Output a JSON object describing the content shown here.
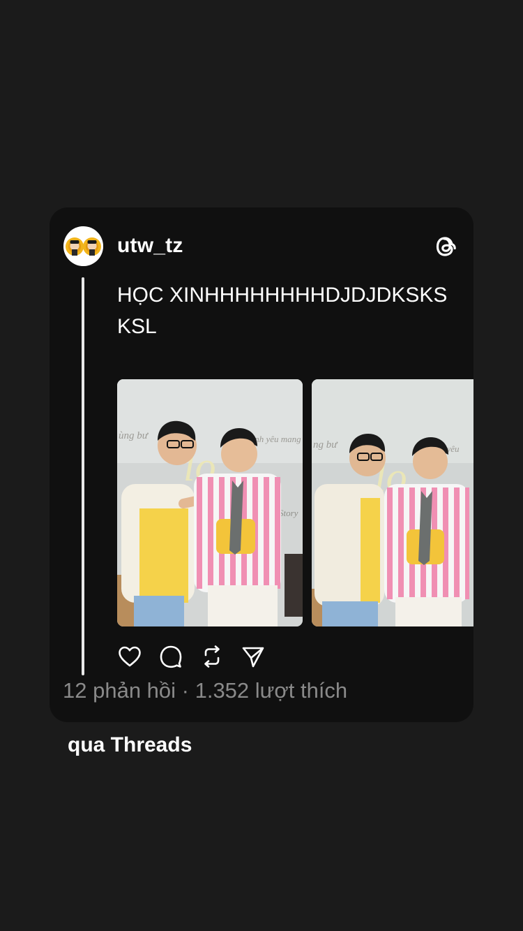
{
  "post": {
    "username": "utw_tz",
    "text": "HỌC XINHHHHHHHHDJDJDKSKSKSL",
    "stats": "12 phản hồi · 1.352 lượt thích",
    "images": [
      {
        "icon": "photo-two-men-pink-striped-shirt"
      },
      {
        "icon": "photo-two-men-pink-striped-shirt"
      }
    ]
  },
  "footer": {
    "via_label": "qua Threads"
  },
  "icons": {
    "like": "heart-icon",
    "reply": "comment-icon",
    "repost": "repost-icon",
    "share": "send-icon",
    "brand": "threads-logo-icon"
  },
  "colors": {
    "background": "#1b1b1b",
    "card": "#101010",
    "text": "#ffffff",
    "muted": "#8a8a8a"
  }
}
